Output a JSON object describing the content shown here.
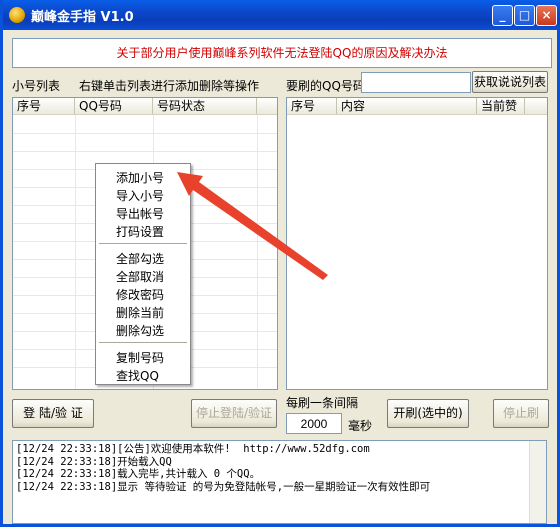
{
  "window": {
    "title": "巅峰金手指 V1.0"
  },
  "notice": "关于部分用户使用巅峰系列软件无法登陆QQ的原因及解决办法",
  "left_panel": {
    "label": "小号列表",
    "hint": "右键单击列表进行添加删除等操作",
    "columns": [
      "序号",
      "QQ号码",
      "号码状态"
    ]
  },
  "right_panel": {
    "qq_label": "要刷的QQ号码",
    "qq_value": "",
    "fetch_button": "获取说说列表",
    "columns": [
      "序号",
      "内容",
      "当前赞"
    ]
  },
  "context_menu": {
    "group1": [
      "添加小号",
      "导入小号",
      "导出帐号",
      "打码设置"
    ],
    "group2": [
      "全部勾选",
      "全部取消",
      "修改密码",
      "删除当前",
      "删除勾选"
    ],
    "group3": [
      "复制号码",
      "查找QQ"
    ]
  },
  "controls": {
    "login_button": "登 陆/验 证",
    "stop_login_button": "停止登陆/验证",
    "interval_label": "每刷一条间隔",
    "interval_value": "2000",
    "interval_unit": "毫秒",
    "start_button": "开刷(选中的)",
    "stop_button": "停止刷"
  },
  "log": [
    "[12/24 22:33:18][公告]欢迎使用本软件!  http://www.52dfg.com",
    "[12/24 22:33:18]开始载入QQ",
    "[12/24 22:33:18]载入完毕,共计载入 0 个QQ。",
    "[12/24 22:33:18]显示 等待验证 的号为免登陆帐号,一般一星期验证一次有效性即可"
  ],
  "colors": {
    "notice_text": "#d00000",
    "titlebar": "#0a52d9",
    "arrow": "#e8412c"
  },
  "icons": [
    "app-icon",
    "minimize-icon",
    "maximize-icon",
    "close-icon",
    "arrow-annotation-icon"
  ]
}
